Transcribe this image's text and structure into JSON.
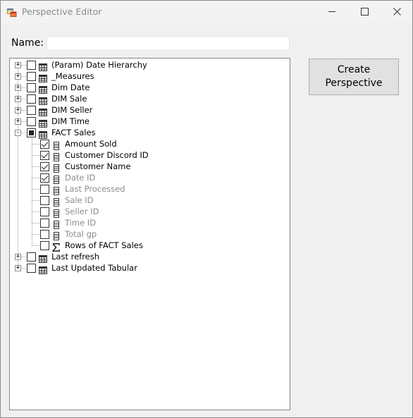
{
  "window": {
    "title": "Perspective Editor",
    "controls": {
      "minimize_icon": "minimize-icon",
      "maximize_icon": "maximize-icon",
      "close_icon": "close-icon"
    }
  },
  "form": {
    "name_label": "Name:",
    "name_value": "",
    "create_button_line1": "Create",
    "create_button_line2": "Perspective"
  },
  "tree": {
    "items": [
      {
        "label": "(Param) Date Hierarchy",
        "checked": "unchecked",
        "expanded": false
      },
      {
        "label": "_Measures",
        "checked": "unchecked",
        "expanded": false
      },
      {
        "label": "Dim Date",
        "checked": "unchecked",
        "expanded": false
      },
      {
        "label": "DIM Sale",
        "checked": "unchecked",
        "expanded": false
      },
      {
        "label": "DIM Seller",
        "checked": "unchecked",
        "expanded": false
      },
      {
        "label": "DIM Time",
        "checked": "unchecked",
        "expanded": false
      },
      {
        "label": "FACT Sales",
        "checked": "partial",
        "expanded": true,
        "children": [
          {
            "label": "Amount Sold",
            "checked": "checked",
            "hidden": false,
            "icon": "column-icon"
          },
          {
            "label": "Customer Discord ID",
            "checked": "checked",
            "hidden": false,
            "icon": "column-icon"
          },
          {
            "label": "Customer Name",
            "checked": "checked",
            "hidden": false,
            "icon": "column-icon"
          },
          {
            "label": "Date ID",
            "checked": "checked",
            "hidden": true,
            "icon": "column-icon"
          },
          {
            "label": "Last Processed",
            "checked": "unchecked",
            "hidden": true,
            "icon": "column-icon"
          },
          {
            "label": "Sale ID",
            "checked": "unchecked",
            "hidden": true,
            "icon": "column-icon"
          },
          {
            "label": "Seller ID",
            "checked": "unchecked",
            "hidden": true,
            "icon": "column-icon"
          },
          {
            "label": "Time ID",
            "checked": "unchecked",
            "hidden": true,
            "icon": "column-icon"
          },
          {
            "label": "Total gp",
            "checked": "unchecked",
            "hidden": true,
            "icon": "column-icon"
          },
          {
            "label": "Rows of FACT Sales",
            "checked": "unchecked",
            "hidden": false,
            "icon": "sigma-measure-icon"
          }
        ]
      },
      {
        "label": "Last refresh",
        "checked": "unchecked",
        "expanded": false
      },
      {
        "label": "Last Updated Tabular",
        "checked": "unchecked",
        "expanded": false
      }
    ]
  },
  "colors": {
    "dim_text": "#8d8d8d",
    "tree_border": "#828790",
    "button_bg": "#e1e1e1"
  }
}
